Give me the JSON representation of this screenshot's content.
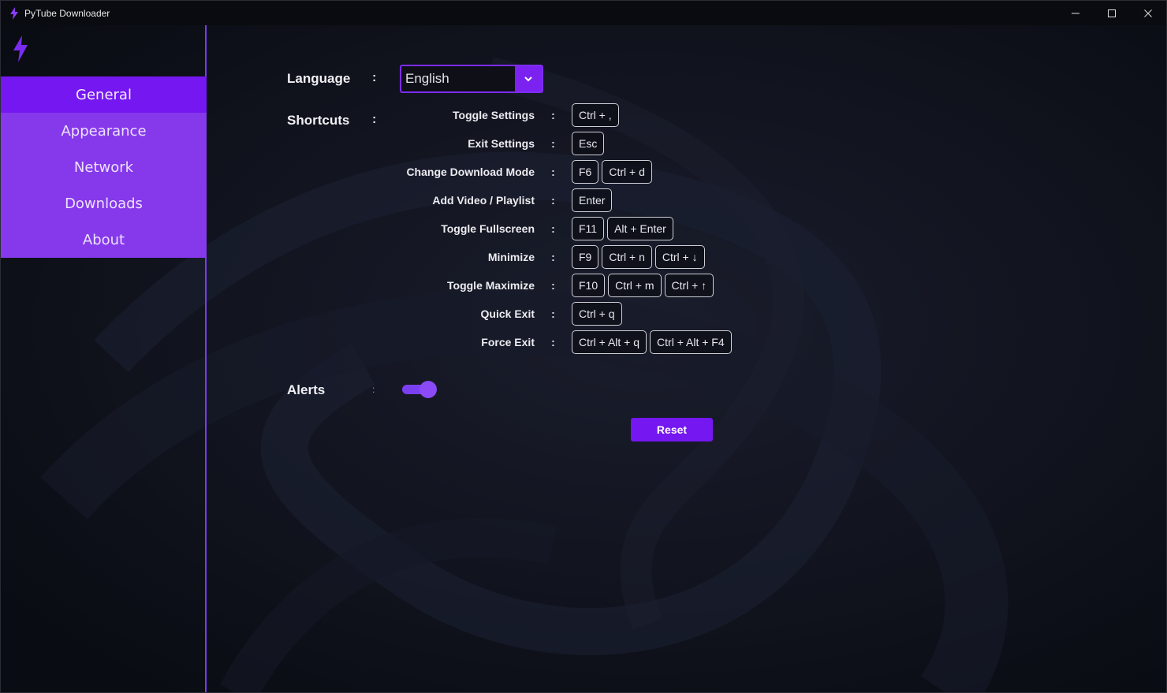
{
  "window": {
    "title": "PyTube Downloader",
    "icons": {
      "app": "lightning-bolt-icon",
      "minimize": "minimize-icon",
      "maximize": "maximize-icon",
      "close": "close-icon"
    }
  },
  "colors": {
    "accent": "#7517f0",
    "sidebar_bg": "#8639ea",
    "background": "#0b0d15"
  },
  "sidebar": {
    "logo": "lightning-bolt-icon",
    "items": [
      {
        "label": "General",
        "active": true
      },
      {
        "label": "Appearance",
        "active": false
      },
      {
        "label": "Network",
        "active": false
      },
      {
        "label": "Downloads",
        "active": false
      },
      {
        "label": "About",
        "active": false
      }
    ]
  },
  "settings": {
    "language_label": "Language",
    "language_value": "English",
    "shortcuts_label": "Shortcuts",
    "alerts_label": "Alerts",
    "alerts_enabled": true,
    "colon": ":",
    "reset_label": "Reset",
    "shortcuts": [
      {
        "name": "Toggle Settings",
        "keys": [
          "Ctrl + ,"
        ]
      },
      {
        "name": "Exit Settings",
        "keys": [
          "Esc"
        ]
      },
      {
        "name": "Change Download Mode",
        "keys": [
          "F6",
          "Ctrl + d"
        ]
      },
      {
        "name": "Add Video / Playlist",
        "keys": [
          "Enter"
        ]
      },
      {
        "name": "Toggle Fullscreen",
        "keys": [
          "F11",
          "Alt + Enter"
        ]
      },
      {
        "name": "Minimize",
        "keys": [
          "F9",
          "Ctrl + n",
          "Ctrl + ↓"
        ]
      },
      {
        "name": "Toggle Maximize",
        "keys": [
          "F10",
          "Ctrl + m",
          "Ctrl + ↑"
        ]
      },
      {
        "name": "Quick Exit",
        "keys": [
          "Ctrl + q"
        ]
      },
      {
        "name": "Force Exit",
        "keys": [
          "Ctrl + Alt + q",
          "Ctrl + Alt + F4"
        ]
      }
    ]
  }
}
